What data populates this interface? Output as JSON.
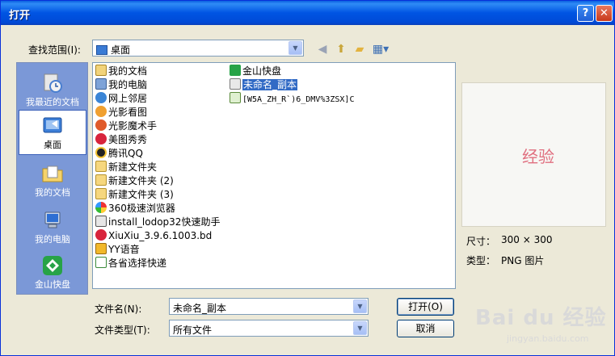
{
  "window": {
    "title": "打开"
  },
  "lookin": {
    "label": "查找范围(I):",
    "value": "桌面"
  },
  "places": [
    {
      "label": "我最近的文档",
      "icon": "recent-docs-icon"
    },
    {
      "label": "桌面",
      "icon": "desktop-icon"
    },
    {
      "label": "我的文档",
      "icon": "my-documents-icon"
    },
    {
      "label": "我的电脑",
      "icon": "my-computer-icon"
    },
    {
      "label": "金山快盘",
      "icon": "kuaipan-icon"
    }
  ],
  "files_col1": [
    {
      "name": "我的文档",
      "icon": "folder-doc-icon"
    },
    {
      "name": "我的电脑",
      "icon": "computer-icon"
    },
    {
      "name": "网上邻居",
      "icon": "network-icon"
    },
    {
      "name": "光影看图",
      "icon": "viewer-icon"
    },
    {
      "name": "光影魔术手",
      "icon": "magic-icon"
    },
    {
      "name": "美图秀秀",
      "icon": "meitu-icon"
    },
    {
      "name": "腾讯QQ",
      "icon": "qq-icon"
    },
    {
      "name": "新建文件夹",
      "icon": "folder-icon"
    },
    {
      "name": "新建文件夹 (2)",
      "icon": "folder-icon"
    },
    {
      "name": "新建文件夹 (3)",
      "icon": "folder-icon"
    },
    {
      "name": "360极速浏览器",
      "icon": "browser-icon"
    },
    {
      "name": "install_lodop32快速助手",
      "icon": "installer-icon"
    },
    {
      "name": "XiuXiu_3.9.6.1003.bd",
      "icon": "xiuxiu-icon"
    },
    {
      "name": "YY语音",
      "icon": "yy-icon"
    },
    {
      "name": "各省选择快递",
      "icon": "shortcut-icon"
    }
  ],
  "files_col2": [
    {
      "name": "金山快盘",
      "icon": "kuaipan-icon"
    },
    {
      "name": "未命名_副本",
      "icon": "png-file-icon"
    },
    {
      "name": "[W5A_ZH_R`)6_DMV%3ZSX]C",
      "icon": "jpeg-file-icon"
    }
  ],
  "preview": {
    "watermark": "经验"
  },
  "info": {
    "size_label": "尺寸：",
    "size_value": "300 × 300",
    "type_label": "类型：",
    "type_value": "PNG 图片"
  },
  "filename": {
    "label": "文件名(N):",
    "value": "未命名_副本"
  },
  "filetype": {
    "label": "文件类型(T):",
    "value": "所有文件"
  },
  "buttons": {
    "open": "打开(O)",
    "cancel": "取消"
  },
  "branding": {
    "logo": "Bai du 经验",
    "url": "jingyan.baidu.com"
  }
}
